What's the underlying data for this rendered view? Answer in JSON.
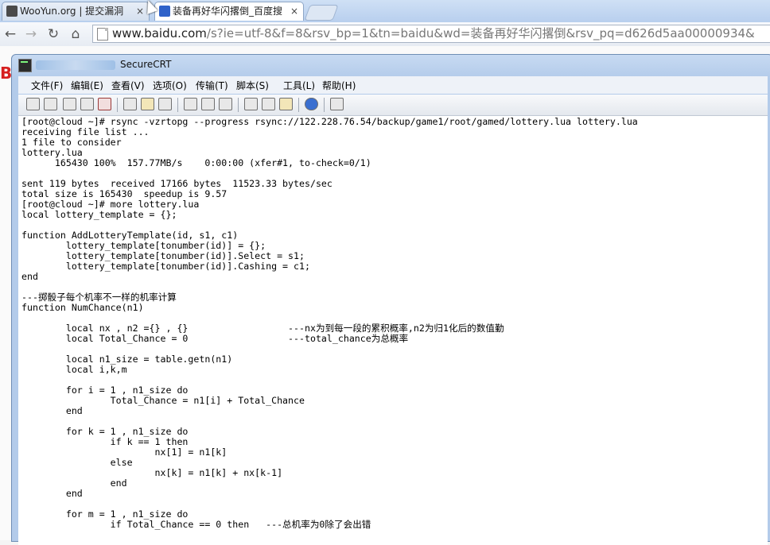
{
  "browser": {
    "tabs": [
      {
        "label": "WooYun.org | 提交漏洞",
        "favicon_color": "#4a4a4a"
      },
      {
        "label": "装备再好华闪撂倒_百度搜",
        "favicon_color": "#2f62c9"
      }
    ],
    "close_glyph": "×",
    "url_host": "www.baidu.com",
    "url_rest": "/s?ie=utf-8&f=8&rsv_bp=1&tn=baidu&wd=装备再好华闪撂倒&rsv_pq=d626d5aa00000934&"
  },
  "background_page": {
    "logo_letter": "B"
  },
  "crt": {
    "title": "SecureCRT",
    "menu": [
      "文件(F)",
      "编辑(E)",
      "查看(V)",
      "选项(O)",
      "传输(T)",
      "脚本(S)",
      "工具(L)",
      "帮助(H)"
    ],
    "terminal_lines": [
      "[root@cloud ~]# rsync -vzrtopg --progress rsync://122.228.76.54/backup/game1/root/gamed/lottery.lua lottery.lua",
      "receiving file list ...",
      "1 file to consider",
      "lottery.lua",
      "      165430 100%  157.77MB/s    0:00:00 (xfer#1, to-check=0/1)",
      "",
      "sent 119 bytes  received 17166 bytes  11523.33 bytes/sec",
      "total size is 165430  speedup is 9.57",
      "[root@cloud ~]# more lottery.lua",
      "local lottery_template = {};",
      "",
      "function AddLotteryTemplate(id, s1, c1)",
      "        lottery_template[tonumber(id)] = {};",
      "        lottery_template[tonumber(id)].Select = s1;",
      "        lottery_template[tonumber(id)].Cashing = c1;",
      "end",
      "",
      "---掷骰子每个机率不一样的机率计算",
      "function NumChance(n1)",
      "",
      "        local nx , n2 ={} , {}                  ---nx为到每一段的累积概率,n2为归1化后的数值勤",
      "        local Total_Chance = 0                  ---total_chance为总概率",
      "",
      "        local n1_size = table.getn(n1)",
      "        local i,k,m",
      "",
      "        for i = 1 , n1_size do",
      "                Total_Chance = n1[i] + Total_Chance",
      "        end",
      "",
      "        for k = 1 , n1_size do",
      "                if k == 1 then",
      "                        nx[1] = n1[k]",
      "                else",
      "                        nx[k] = n1[k] + nx[k-1]",
      "                end",
      "        end",
      "",
      "        for m = 1 , n1_size do",
      "                if Total_Chance == 0 then   ---总机率为0除了会出错"
    ]
  }
}
